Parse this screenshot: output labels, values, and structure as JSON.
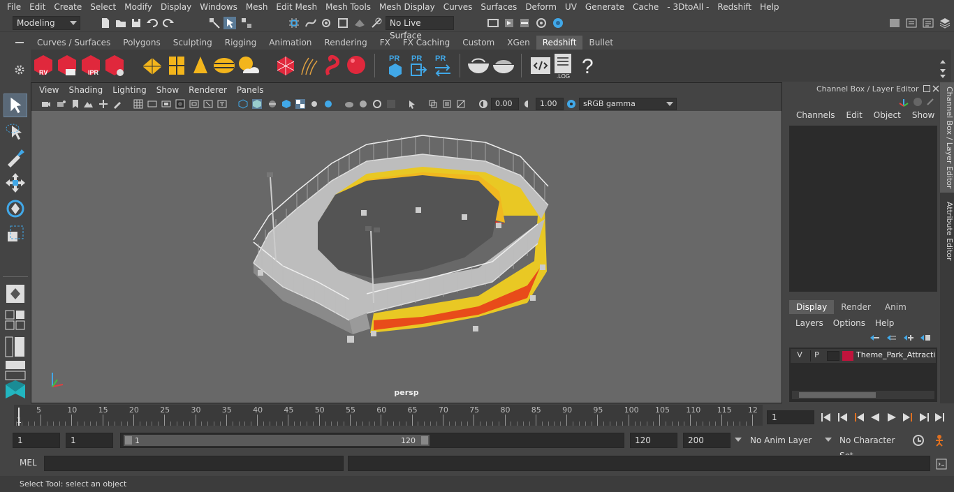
{
  "menubar": {
    "items": [
      "File",
      "Edit",
      "Create",
      "Select",
      "Modify",
      "Display",
      "Windows",
      "Mesh",
      "Edit Mesh",
      "Mesh Tools",
      "Mesh Display",
      "Curves",
      "Surfaces",
      "Deform",
      "UV",
      "Generate",
      "Cache",
      "- 3DtoAll -",
      "Redshift",
      "Help"
    ]
  },
  "statusline": {
    "mode": "Modeling",
    "live_surface": "No Live Surface"
  },
  "shelf": {
    "tabs": [
      "Curves / Surfaces",
      "Polygons",
      "Sculpting",
      "Rigging",
      "Animation",
      "Rendering",
      "FX",
      "FX Caching",
      "Custom",
      "XGen",
      "Redshift",
      "Bullet"
    ],
    "active_tab": "Redshift",
    "labels": {
      "rv": "RV",
      "ipr": "IPR",
      "pr": "PR",
      "log": ".LOG",
      "help": "?"
    }
  },
  "viewport": {
    "menu": [
      "View",
      "Shading",
      "Lighting",
      "Show",
      "Renderer",
      "Panels"
    ],
    "exposure": "0.00",
    "gamma": "1.00",
    "colorspace": "sRGB gamma",
    "camera": "persp"
  },
  "channelbox": {
    "title": "Channel Box / Layer Editor",
    "menu": [
      "Channels",
      "Edit",
      "Object",
      "Show"
    ],
    "display_tabs": [
      "Display",
      "Render",
      "Anim"
    ],
    "active_display_tab": "Display",
    "layer_menu": [
      "Layers",
      "Options",
      "Help"
    ],
    "layer": {
      "v": "V",
      "p": "P",
      "name": "Theme_Park_Attraction",
      "color": "#c0143c"
    },
    "side_tabs": [
      "Channel Box / Layer Editor",
      "Attribute Editor"
    ]
  },
  "timeline": {
    "ticks": [
      "5",
      "10",
      "15",
      "20",
      "25",
      "30",
      "35",
      "40",
      "45",
      "50",
      "55",
      "60",
      "65",
      "70",
      "75",
      "80",
      "85",
      "90",
      "95",
      "100",
      "105",
      "110",
      "115",
      "12"
    ],
    "start_marker": "1",
    "current_frame": "1"
  },
  "range": {
    "start": "1",
    "playback_start": "1",
    "slider_start": "1",
    "slider_end": "120",
    "playback_end": "120",
    "end": "200",
    "anim_layer": "No Anim Layer",
    "character_set": "No Character Set"
  },
  "command": {
    "label": "MEL"
  },
  "help": {
    "text": "Select Tool: select an object"
  },
  "colors": {
    "accent_blue": "#41a8e8",
    "redshift_red": "#e0283c",
    "active_tab": "#5d5d5d"
  }
}
